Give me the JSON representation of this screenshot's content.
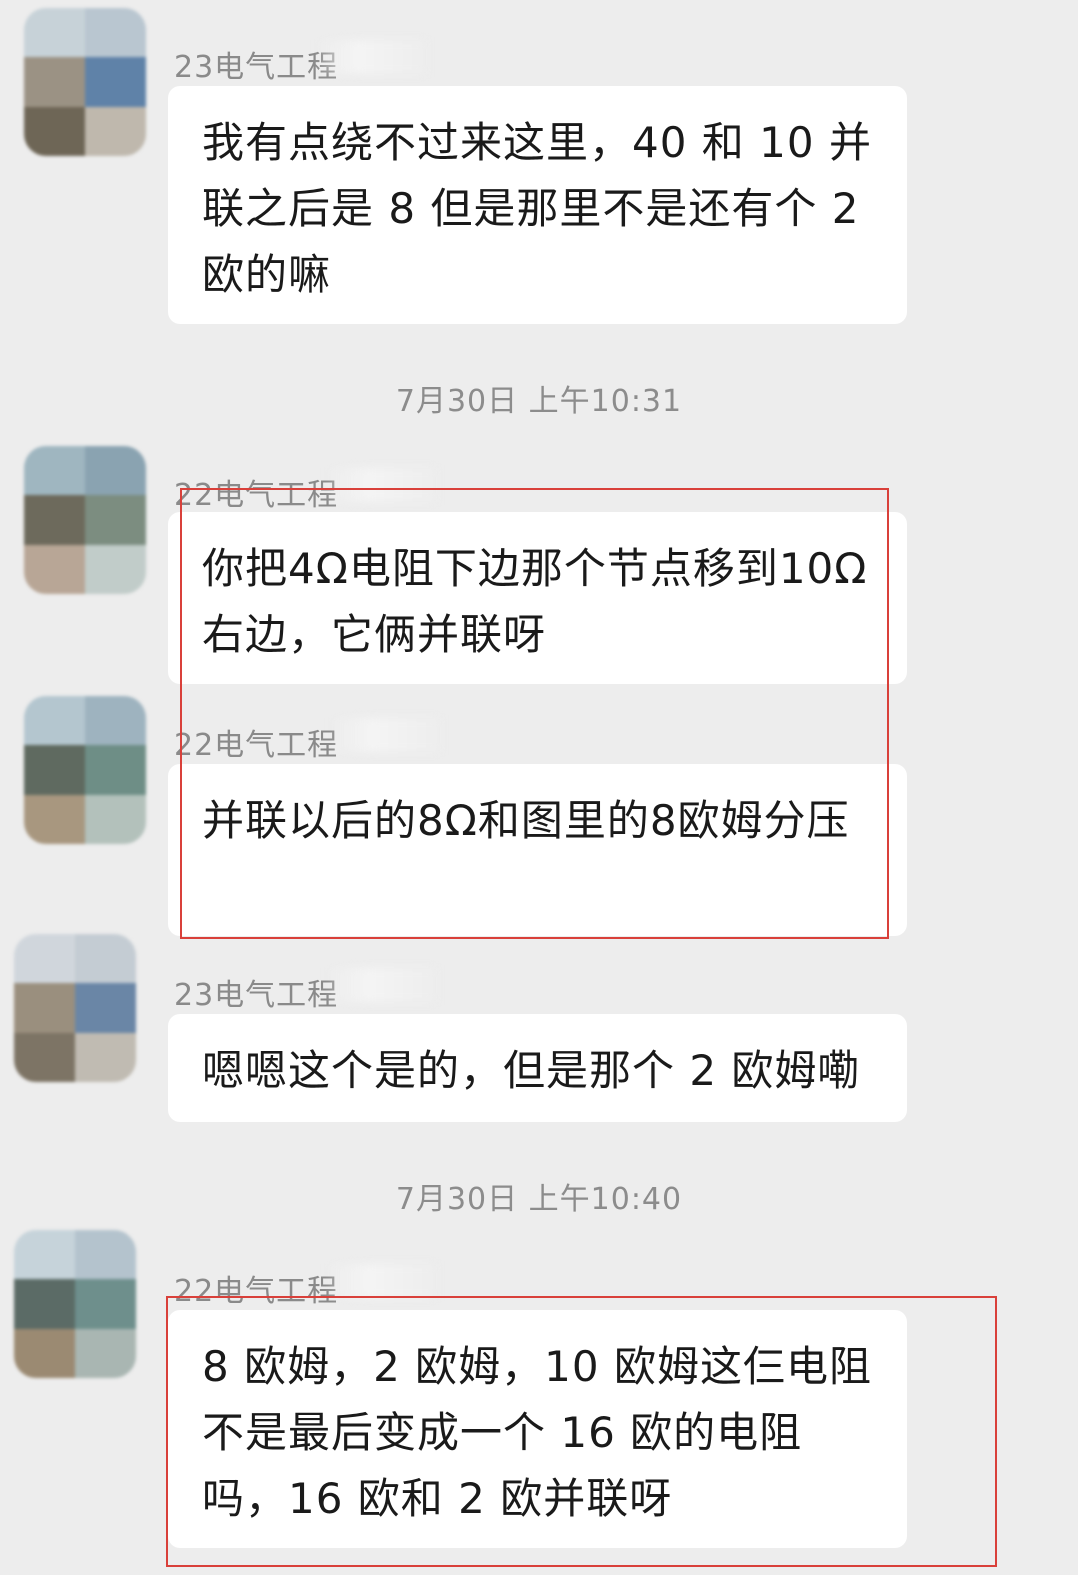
{
  "messages": [
    {
      "sender": "23电气工程",
      "text": "我有点绕不过来这里，40 和 10 并联之后是 8 但是那里不是还有个 2 欧的嘛"
    },
    {
      "sender": "22电气工程",
      "text": "你把4Ω电阻下边那个节点移到10Ω右边，它俩并联呀"
    },
    {
      "sender": "22电气工程",
      "text": "并联以后的8Ω和图里的8欧姆分压"
    },
    {
      "sender": "23电气工程",
      "text": "嗯嗯这个是的，但是那个 2 欧姆嘞"
    },
    {
      "sender": "22电气工程",
      "text": "8 欧姆，2 欧姆，10 欧姆这仨电阻不是最后变成一个 16 欧的电阻吗，16 欧和 2 欧并联呀"
    }
  ],
  "timestamps": [
    "7月30日 上午10:31",
    "7月30日 上午10:40"
  ],
  "colors": {
    "background": "#ededed",
    "bubble": "#ffffff",
    "highlight_box": "#d9403a",
    "meta_text": "#8a8a8a"
  }
}
